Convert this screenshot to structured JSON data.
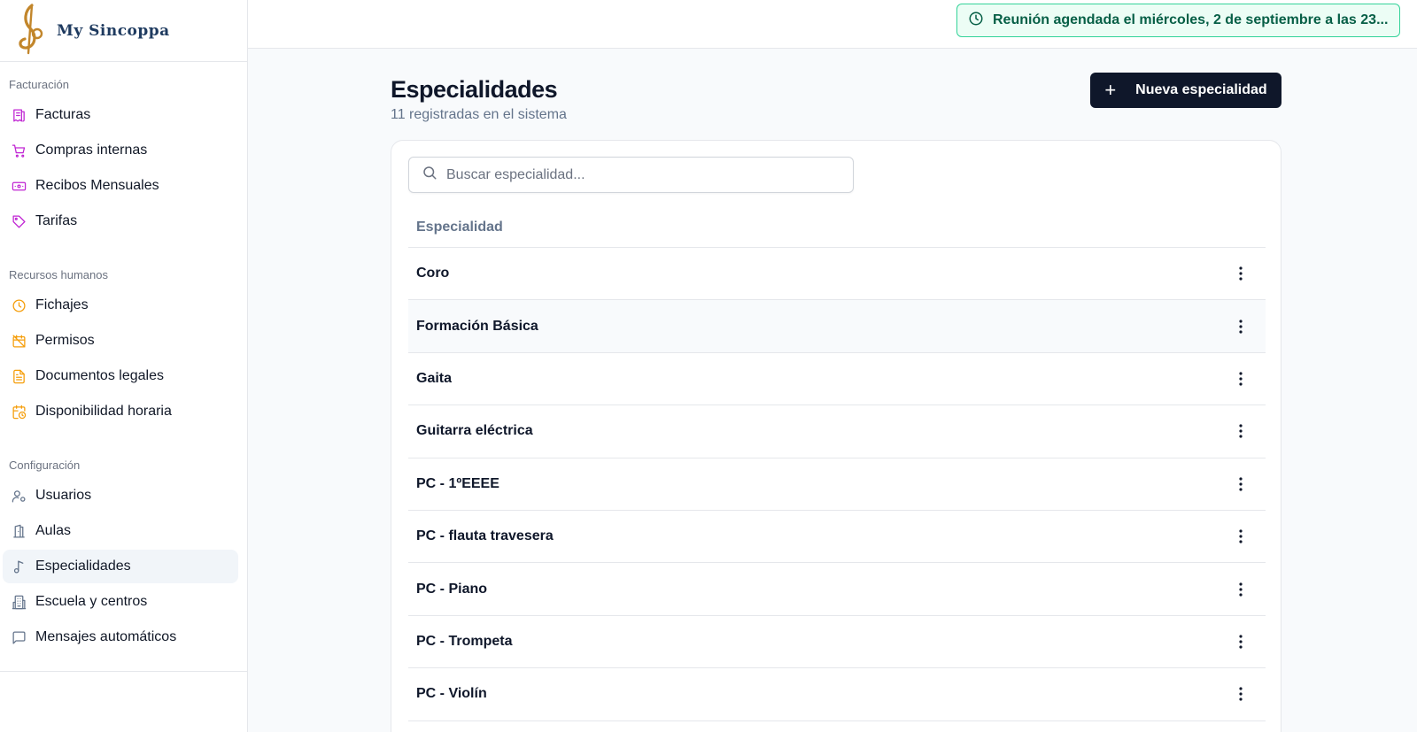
{
  "brand": {
    "name": "My Sincoppa",
    "logo_icon": "treble-clef-icon"
  },
  "sidebar": {
    "sections": [
      {
        "title": "Facturación",
        "items": [
          {
            "label": "Facturas",
            "icon": "receipt-icon",
            "color": "#c026d3"
          },
          {
            "label": "Compras internas",
            "icon": "shopping-cart-icon",
            "color": "#c026d3"
          },
          {
            "label": "Recibos Mensuales",
            "icon": "banknote-icon",
            "color": "#c026d3"
          },
          {
            "label": "Tarifas",
            "icon": "tag-icon",
            "color": "#c026d3"
          }
        ]
      },
      {
        "title": "Recursos humanos",
        "items": [
          {
            "label": "Fichajes",
            "icon": "clock-icon",
            "color": "#f59e0b"
          },
          {
            "label": "Permisos",
            "icon": "calendar-off-icon",
            "color": "#f59e0b"
          },
          {
            "label": "Documentos legales",
            "icon": "file-text-icon",
            "color": "#f59e0b"
          },
          {
            "label": "Disponibilidad horaria",
            "icon": "calendar-clock-icon",
            "color": "#f59e0b"
          }
        ]
      },
      {
        "title": "Configuración",
        "items": [
          {
            "label": "Usuarios",
            "icon": "user-cog-icon",
            "color": "#64748b"
          },
          {
            "label": "Aulas",
            "icon": "door-icon",
            "color": "#64748b"
          },
          {
            "label": "Especialidades",
            "icon": "music-note-icon",
            "color": "#64748b",
            "active": true
          },
          {
            "label": "Escuela y centros",
            "icon": "building-icon",
            "color": "#64748b"
          },
          {
            "label": "Mensajes automáticos",
            "icon": "message-square-icon",
            "color": "#64748b"
          }
        ]
      }
    ]
  },
  "notice": {
    "text": "Reunión agendada el miércoles, 2 de septiembre a las 23...",
    "icon": "clock-icon",
    "color": "#065f46"
  },
  "page": {
    "title": "Especialidades",
    "subtitle": "11 registradas en el sistema",
    "new_button_label": "Nueva especialidad",
    "new_button_icon": "plus-icon"
  },
  "search": {
    "placeholder": "Buscar especialidad...",
    "value": "",
    "icon": "search-icon"
  },
  "table": {
    "header": "Especialidad",
    "rows": [
      "Coro",
      "Formación Básica",
      "Gaita",
      "Guitarra eléctrica",
      "PC - 1ºEEEE",
      "PC - flauta travesera",
      "PC - Piano",
      "PC - Trompeta",
      "PC - Violín"
    ],
    "row_action_icon": "more-vertical-icon"
  }
}
